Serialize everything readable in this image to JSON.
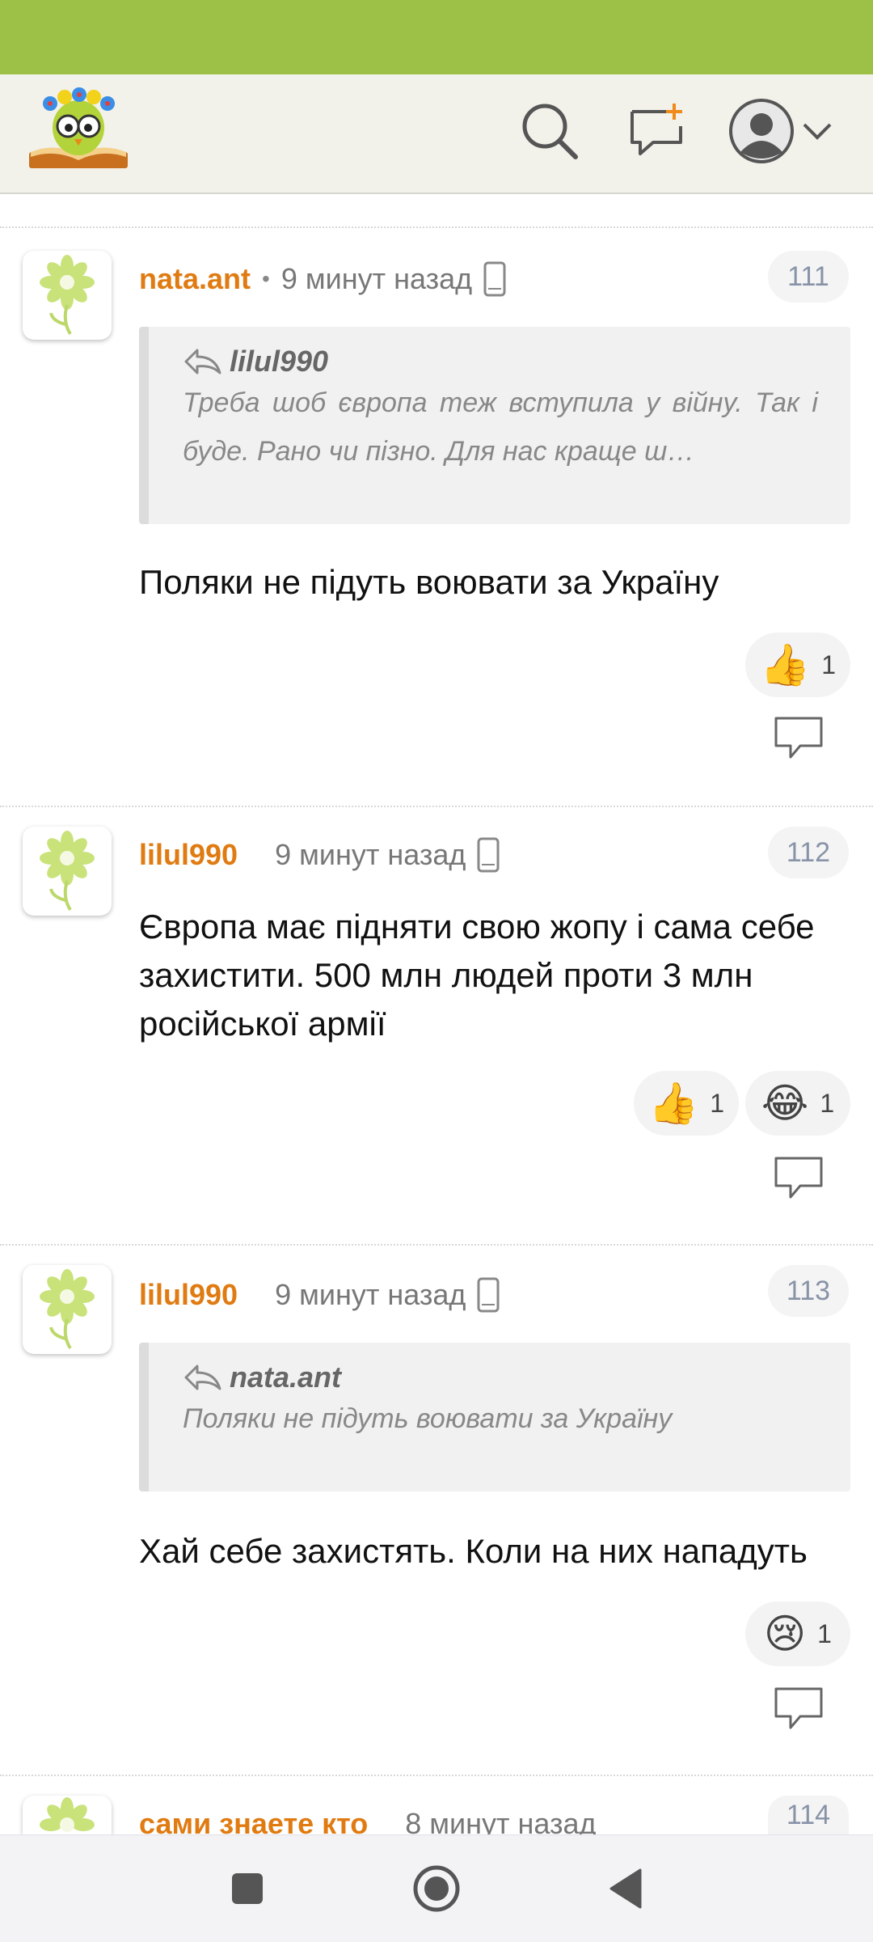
{
  "header": {
    "logo_icon": "owl-on-book-logo",
    "search_icon": "search-icon",
    "new_comment_icon": "new-comment-icon",
    "avatar_icon": "user-avatar-icon",
    "menu_icon": "chevron-down-icon",
    "accent_color": "#9cc146"
  },
  "comments": [
    {
      "username": "nata.ant",
      "separator": "•",
      "time": "9 минут назад",
      "number": "111",
      "quote": {
        "user": "lilul990",
        "text": "Треба шоб європа теж вступила у війну. Так і буде. Рано чи пізно. Для нас краще ш…"
      },
      "text": "Поляки не підуть воювати за Україну",
      "reactions": [
        {
          "emoji": "👍",
          "count": "1"
        }
      ]
    },
    {
      "username": "lilul990",
      "time": "9 минут назад",
      "number": "112",
      "text": "Європа має підняти свою жопу і сама себе захистити. 500 млн людей проти 3 млн російської армії",
      "reactions": [
        {
          "emoji": "👍",
          "count": "1"
        },
        {
          "emoji": "😂",
          "count": "1"
        }
      ]
    },
    {
      "username": "lilul990",
      "time": "9 минут назад",
      "number": "113",
      "quote": {
        "user": "nata.ant",
        "text": "Поляки не підуть воювати за Україну"
      },
      "text": "Хай себе захистять. Коли на них нападуть",
      "reactions": [
        {
          "emoji": "😢",
          "count": "1"
        }
      ]
    },
    {
      "username": "сами знаете кто",
      "time": "8 минут назад",
      "number": "114"
    }
  ],
  "navbar": {
    "recents_icon": "square-icon",
    "home_icon": "circle-home-icon",
    "back_icon": "triangle-back-icon"
  }
}
